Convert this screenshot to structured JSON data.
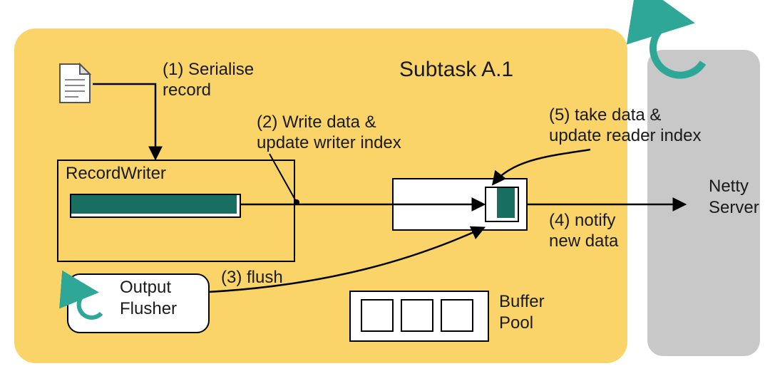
{
  "colors": {
    "subtask_bg": "#fad369",
    "netty_bg": "#c8c8c8",
    "accent": "#176e61",
    "arc_teal": "#2fa796"
  },
  "subtask": {
    "title": "Subtask A.1"
  },
  "doc_icon": {
    "name": "document-icon"
  },
  "record_writer": {
    "label": "RecordWriter"
  },
  "output_flusher": {
    "line1": "Output",
    "line2": "Flusher"
  },
  "buffer_pool": {
    "line1": "Buffer",
    "line2": "Pool"
  },
  "netty_server": {
    "line1": "Netty",
    "line2": "Server"
  },
  "steps": {
    "s1": "(1) Serialise\nrecord",
    "s2": "(2) Write data &\nupdate writer index",
    "s3": "(3) flush",
    "s4": "(4) notify\nnew data",
    "s5": "(5) take data &\nupdate reader index"
  }
}
